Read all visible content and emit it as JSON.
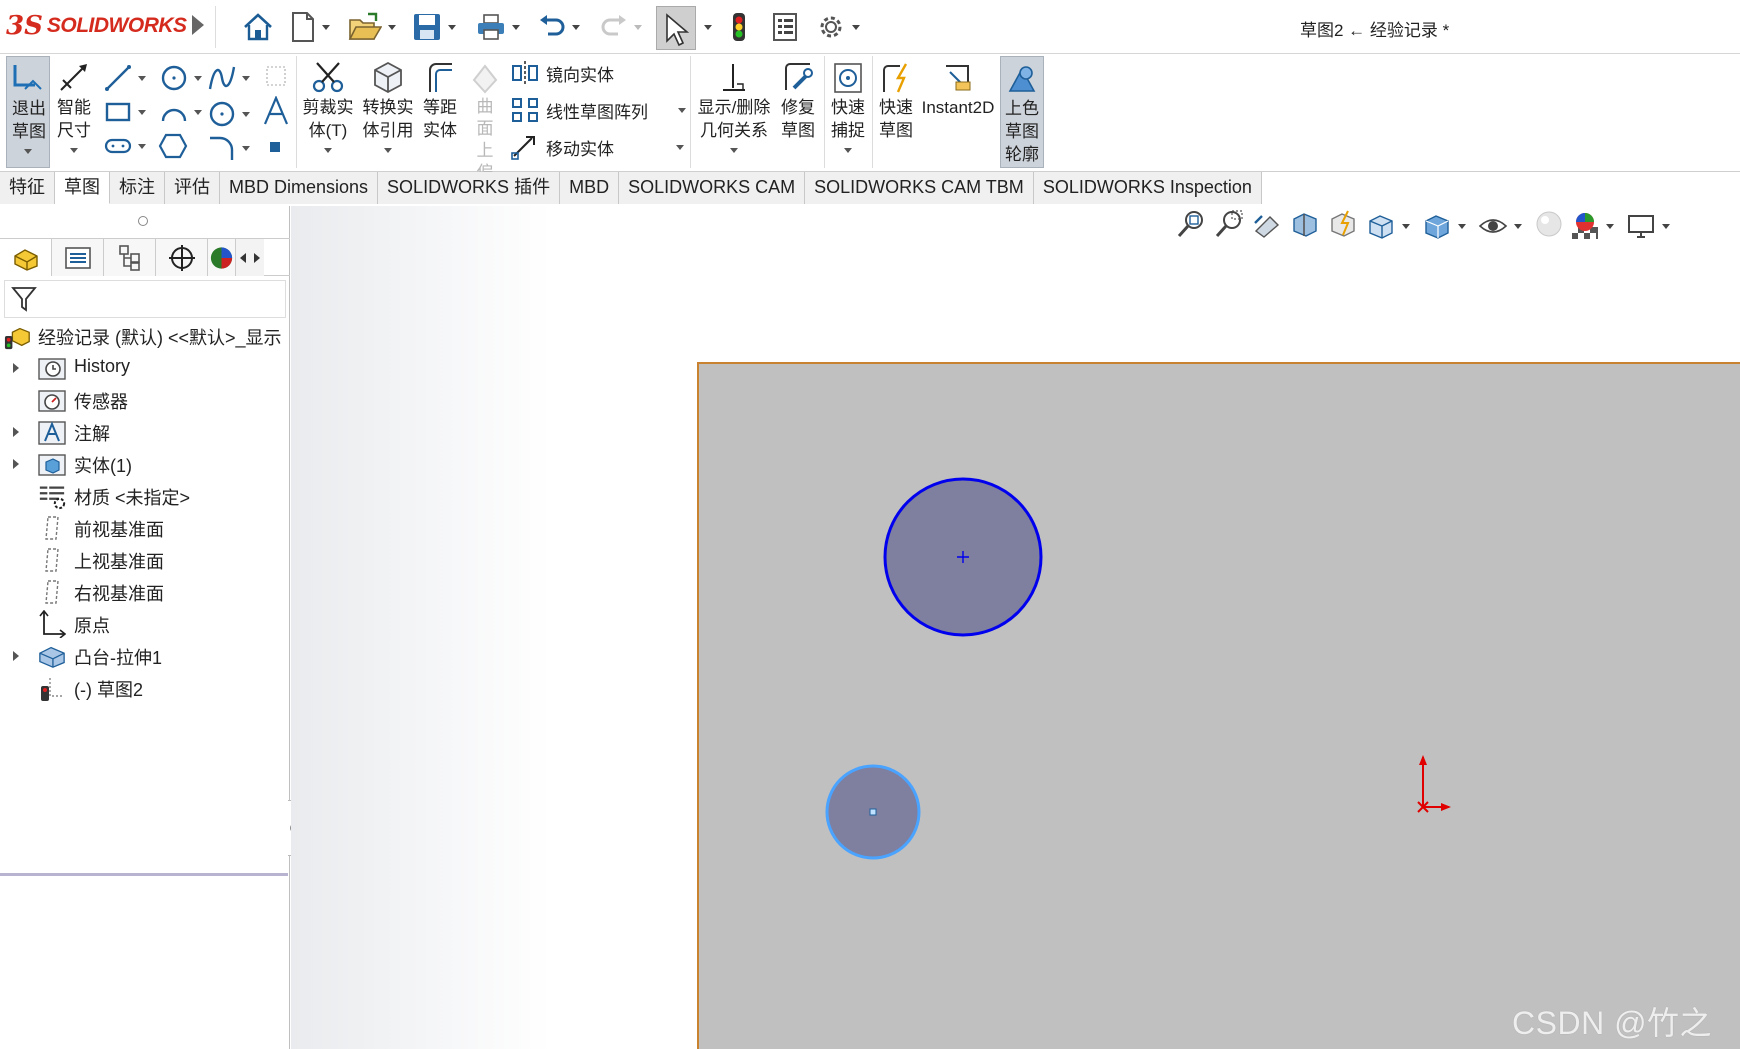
{
  "app": {
    "brand_prefix": "3S",
    "brand": "SOLIDWORKS",
    "document_title": "草图2 ← 经验记录 *"
  },
  "ribbon": {
    "exit_sketch": "退出草图",
    "smart_dim": "智能尺寸",
    "trim": "剪裁实体(T)",
    "convert": "转换实体引用",
    "offset": "等距实体",
    "surface_offset": "曲面上偏移",
    "mirror": "镜向实体",
    "linear_pattern": "线性草图阵列",
    "move": "移动实体",
    "relations": "显示/删除几何关系",
    "repair": "修复草图",
    "quick_snap": "快速捕捉",
    "rapid_sketch": "快速草图",
    "instant2d": "Instant2D",
    "shaded_contours": "上色草图轮廓"
  },
  "tabs": [
    "特征",
    "草图",
    "标注",
    "评估",
    "MBD Dimensions",
    "SOLIDWORKS 插件",
    "MBD",
    "SOLIDWORKS CAM",
    "SOLIDWORKS CAM TBM",
    "SOLIDWORKS Inspection"
  ],
  "active_tab": "草图",
  "tree": {
    "root": "经验记录 (默认) <<默认>_显示",
    "items": [
      {
        "label": "History"
      },
      {
        "label": "传感器"
      },
      {
        "label": "注解"
      },
      {
        "label": "实体(1)"
      },
      {
        "label": "材质 <未指定>"
      },
      {
        "label": "前视基准面"
      },
      {
        "label": "上视基准面"
      },
      {
        "label": "右视基准面"
      },
      {
        "label": "原点"
      },
      {
        "label": "凸台-拉伸1"
      },
      {
        "label": "(-) 草图2"
      }
    ]
  },
  "colors": {
    "brand": "#d52b1e",
    "sheet": "#c0c0c0",
    "sketch_line": "#0000ee",
    "selected_line": "#4aa3ff",
    "circle_fill": "#7f7fa0"
  },
  "watermark": "CSDN @竹之月"
}
